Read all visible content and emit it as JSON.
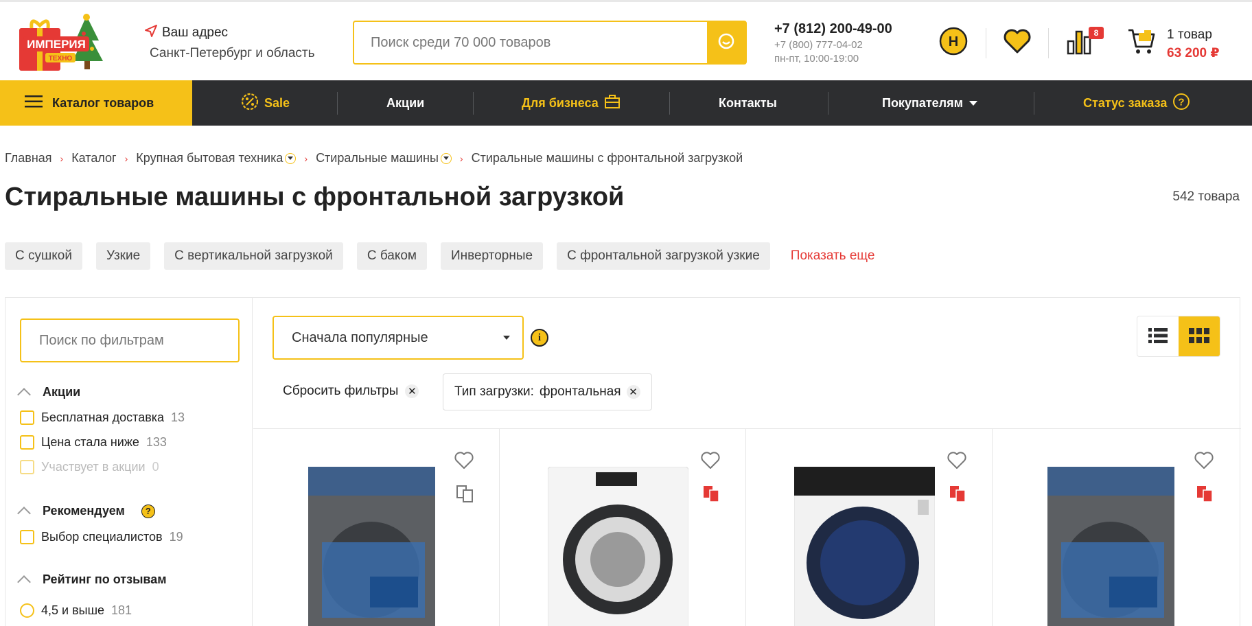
{
  "header": {
    "logo_text": "ИМПЕРИЯ ТЕХНО",
    "address_label": "Ваш адрес",
    "address_value": "Санкт-Петербург и область",
    "search_placeholder": "Поиск среди 70 000 товаров",
    "phone_main": "+7 (812) 200-49-00",
    "phone_second": "+7 (800) 777-04-02",
    "hours": "пн-пт, 10:00-19:00",
    "compare_badge": "8",
    "cart_count": "1 товар",
    "cart_total": "63 200 ₽"
  },
  "nav": {
    "catalog": "Каталог товаров",
    "items": [
      "Sale",
      "Акции",
      "Для бизнеса",
      "Контакты",
      "Покупателям",
      "Статус заказа"
    ]
  },
  "breadcrumb": [
    "Главная",
    "Каталог",
    "Крупная бытовая техника",
    "Стиральные машины",
    "Стиральные машины с фронтальной загрузкой"
  ],
  "page": {
    "title": "Стиральные машины с фронтальной загрузкой",
    "count": "542 товара"
  },
  "chips": [
    "С сушкой",
    "Узкие",
    "С вертикальной загрузкой",
    "С баком",
    "Инверторные",
    "С фронтальной загрузкой узкие"
  ],
  "chips_more": "Показать еще",
  "filters": {
    "search_placeholder": "Поиск по фильтрам",
    "groups": [
      {
        "title": "Акции",
        "options": [
          {
            "label": "Бесплатная доставка",
            "count": "13"
          },
          {
            "label": "Цена стала ниже",
            "count": "133"
          },
          {
            "label": "Участвует в акции",
            "count": "0"
          }
        ]
      },
      {
        "title": "Рекомендуем",
        "options": [
          {
            "label": "Выбор специалистов",
            "count": "19"
          }
        ]
      },
      {
        "title": "Рейтинг по отзывам",
        "options": [
          {
            "label": "4,5 и выше",
            "count": "181"
          }
        ]
      }
    ]
  },
  "toolbar": {
    "sort_value": "Сначала популярные",
    "reset_label": "Сбросить фильтры",
    "applied_filter_name": "Тип загрузки:",
    "applied_filter_value": "фронтальная"
  },
  "colors": {
    "accent": "#f5c118",
    "dark": "#2d2e30",
    "red": "#e53935"
  }
}
